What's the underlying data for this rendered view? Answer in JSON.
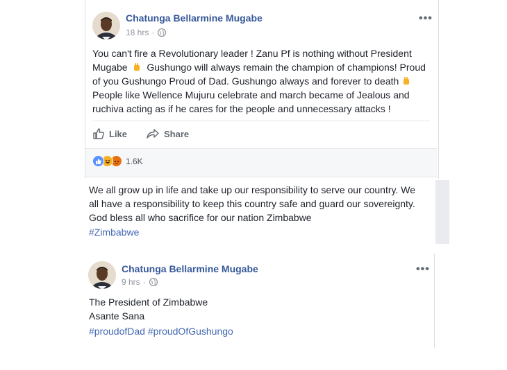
{
  "post1": {
    "author": "Chatunga Bellarmine Mugabe",
    "time": "18 hrs",
    "dot": "·",
    "lines": [
      "You can't fire a Revolutionary leader ! Zanu Pf is nothing without President",
      "Mugabe",
      "Gushungo will always remain the champion of champions! Proud",
      "of you Gushungo Proud of Dad. Gushungo always and forever to death",
      "People like Wellence Mujuru celebrate and march became of Jealous and",
      "ruchiva acting as if he cares for the people and unnecessary attacks !"
    ],
    "like_label": "Like",
    "share_label": "Share",
    "reaction_count": "1.6K"
  },
  "middle": {
    "lines": [
      "We all grow up in life and take up our responsibility to serve our country. We",
      "all have a responsibility to keep this country safe and guard our sovereignty.",
      "God bless all who sacrifice for our nation Zimbabwe"
    ],
    "hashtag": "#Zimbabwe"
  },
  "post2": {
    "author": "Chatunga Bellarmine Mugabe",
    "time": "9 hrs",
    "dot": "·",
    "lines": [
      "The President of Zimbabwe",
      "Asante Sana"
    ],
    "hashtags": "#proudofDad #proudOfGushungo"
  },
  "more_options": "•••",
  "colors": {
    "link": "#4267b2",
    "name": "#365899",
    "meta": "#90949c",
    "like_blue": "#5890ff",
    "haha_yellow": "#f7b125",
    "angry_orange": "#e9710f"
  }
}
